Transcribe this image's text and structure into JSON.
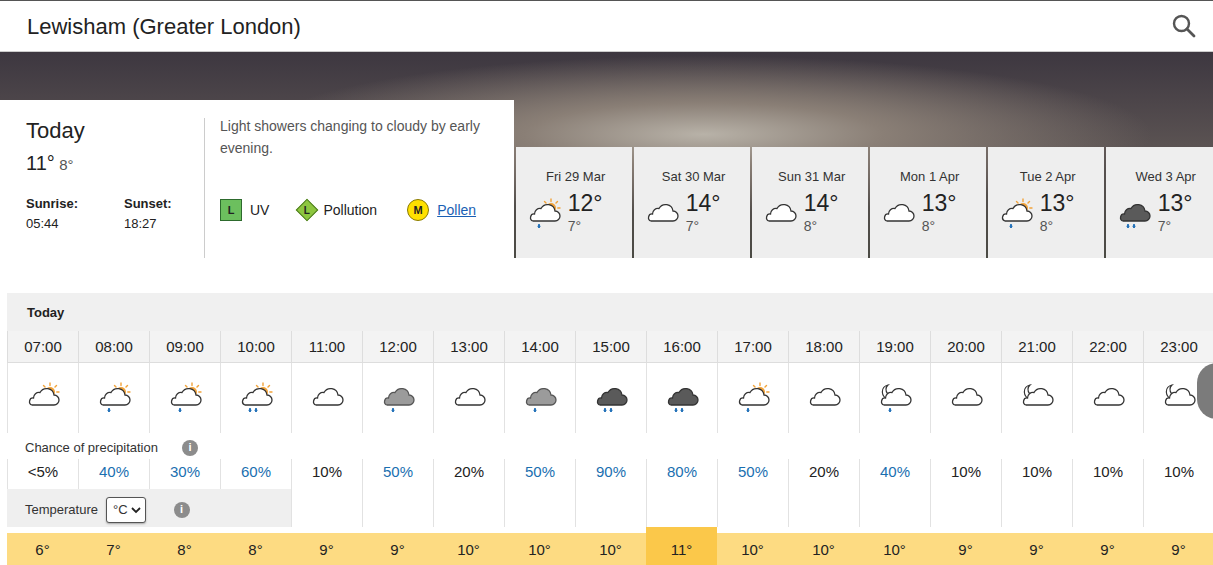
{
  "location": {
    "title": "Lewisham (Greater London)"
  },
  "today": {
    "title": "Today",
    "high": "11°",
    "low": "8°",
    "sunrise_label": "Sunrise:",
    "sunrise": "05:44",
    "sunset_label": "Sunset:",
    "sunset": "18:27",
    "summary": "Light showers changing to cloudy by early evening.",
    "indices": [
      {
        "badge": "L",
        "label": "UV",
        "kind": "square",
        "color": "#6cbf5e",
        "link": false
      },
      {
        "badge": "L",
        "label": "Pollution",
        "kind": "diamond",
        "color": "#8dc63f",
        "link": false
      },
      {
        "badge": "M",
        "label": "Pollen",
        "kind": "circle",
        "color": "#ffe000",
        "link": true
      }
    ]
  },
  "days": [
    {
      "label": "Fri 29 Mar",
      "high": "12°",
      "low": "7°",
      "kind": "sun-cloud-drizzle"
    },
    {
      "label": "Sat 30 Mar",
      "high": "14°",
      "low": "7°",
      "kind": "cloud"
    },
    {
      "label": "Sun 31 Mar",
      "high": "14°",
      "low": "8°",
      "kind": "cloud"
    },
    {
      "label": "Mon 1 Apr",
      "high": "13°",
      "low": "8°",
      "kind": "cloud"
    },
    {
      "label": "Tue 2 Apr",
      "high": "13°",
      "low": "8°",
      "kind": "sun-cloud-drizzle"
    },
    {
      "label": "Wed 3 Apr",
      "high": "13°",
      "low": "7°",
      "kind": "dark-cloud-rain"
    }
  ],
  "hourly": {
    "title": "Today",
    "precip_label": "Chance of precipitation",
    "info": "i",
    "temp_label": "Temperature",
    "unit": "°C",
    "hours": [
      {
        "time": "07:00",
        "kind": "sun-cloud",
        "precip": "<5%",
        "emphasis": false,
        "temp": "6°",
        "peak": false
      },
      {
        "time": "08:00",
        "kind": "sun-cloud-drizzle",
        "precip": "40%",
        "emphasis": true,
        "temp": "7°",
        "peak": false
      },
      {
        "time": "09:00",
        "kind": "sun-cloud-drizzle",
        "precip": "30%",
        "emphasis": true,
        "temp": "8°",
        "peak": false
      },
      {
        "time": "10:00",
        "kind": "sun-cloud-rain",
        "precip": "60%",
        "emphasis": true,
        "temp": "8°",
        "peak": false
      },
      {
        "time": "11:00",
        "kind": "cloud",
        "precip": "10%",
        "emphasis": false,
        "temp": "9°",
        "peak": false
      },
      {
        "time": "12:00",
        "kind": "grey-cloud-drizzle",
        "precip": "50%",
        "emphasis": true,
        "temp": "9°",
        "peak": false
      },
      {
        "time": "13:00",
        "kind": "cloud",
        "precip": "20%",
        "emphasis": false,
        "temp": "10°",
        "peak": false
      },
      {
        "time": "14:00",
        "kind": "grey-cloud-drizzle",
        "precip": "50%",
        "emphasis": true,
        "temp": "10°",
        "peak": false
      },
      {
        "time": "15:00",
        "kind": "dark-cloud-rain",
        "precip": "90%",
        "emphasis": true,
        "temp": "10°",
        "peak": false
      },
      {
        "time": "16:00",
        "kind": "dark-cloud-rain",
        "precip": "80%",
        "emphasis": true,
        "temp": "11°",
        "peak": true
      },
      {
        "time": "17:00",
        "kind": "sun-cloud-drizzle",
        "precip": "50%",
        "emphasis": true,
        "temp": "10°",
        "peak": false
      },
      {
        "time": "18:00",
        "kind": "cloud",
        "precip": "20%",
        "emphasis": false,
        "temp": "10°",
        "peak": false
      },
      {
        "time": "19:00",
        "kind": "moon-cloud-drizzle",
        "precip": "40%",
        "emphasis": true,
        "temp": "10°",
        "peak": false
      },
      {
        "time": "20:00",
        "kind": "cloud",
        "precip": "10%",
        "emphasis": false,
        "temp": "9°",
        "peak": false
      },
      {
        "time": "21:00",
        "kind": "moon-cloud",
        "precip": "10%",
        "emphasis": false,
        "temp": "9°",
        "peak": false
      },
      {
        "time": "22:00",
        "kind": "cloud",
        "precip": "10%",
        "emphasis": false,
        "temp": "9°",
        "peak": false
      },
      {
        "time": "23:00",
        "kind": "moon-cloud",
        "precip": "10%",
        "emphasis": false,
        "temp": "9°",
        "peak": false
      }
    ]
  }
}
